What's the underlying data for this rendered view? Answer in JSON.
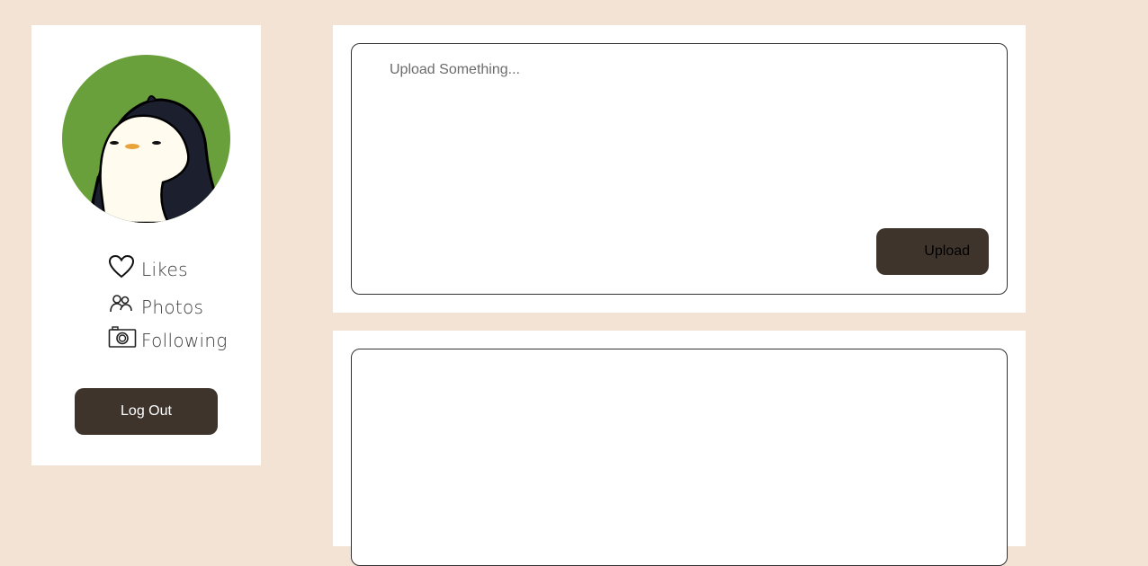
{
  "sidebar": {
    "avatar_icon": "penguin-avatar",
    "nav": [
      {
        "label": "Likes",
        "icon": "heart-icon"
      },
      {
        "label": "Photos",
        "icon": "people-icon"
      },
      {
        "label": "Following",
        "icon": "camera-icon"
      }
    ],
    "logout_label": "Log Out"
  },
  "upload": {
    "placeholder": "Upload Something...",
    "value": "",
    "button_label": "Upload"
  },
  "colors": {
    "background": "#f2e3d5",
    "button": "#3e342c",
    "avatar_bg": "#6aa03c"
  }
}
